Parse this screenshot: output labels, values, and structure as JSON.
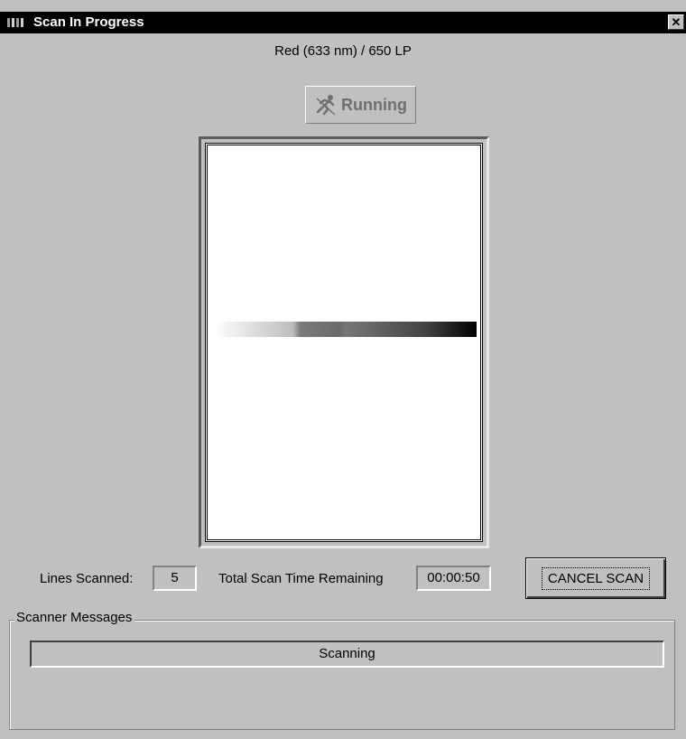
{
  "window": {
    "title": "Scan In Progress",
    "close_label": "✕"
  },
  "scan": {
    "laser_filter": "Red (633 nm) / 650 LP",
    "status": "Running",
    "lines_scanned_label": "Lines Scanned:",
    "lines_scanned_value": "5",
    "time_remaining_label": "Total Scan Time Remaining",
    "time_remaining_value": "00:00:50",
    "cancel_label": "CANCEL SCAN"
  },
  "messages": {
    "group_label": "Scanner Messages",
    "text": "Scanning"
  },
  "icons": {
    "window_icon": "scanner-icon",
    "status_icon": "running-man-icon"
  }
}
